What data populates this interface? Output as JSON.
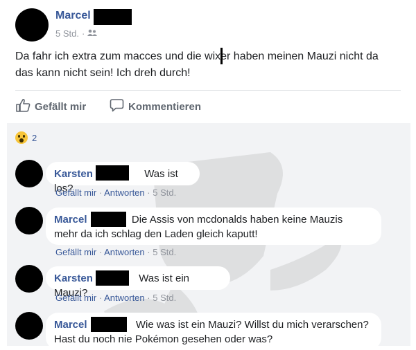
{
  "post": {
    "author": "Marcel",
    "time": "5 Std.",
    "meta_separator": "·",
    "audience_icon": "friends-icon",
    "text_line1": "Da fahr ich extra zum macces und die wixer haben meinen Mauzi nicht da",
    "text_line2": "das kann nicht sein! Ich dreh durch!"
  },
  "actions": {
    "like": "Gefällt mir",
    "like_icon": "thumbs-up-icon",
    "comment": "Kommentieren",
    "comment_icon": "speech-bubble-icon"
  },
  "reactions": {
    "icon": "wow-reaction-icon",
    "count": "2"
  },
  "comment_actions": {
    "like": "Gefällt mir",
    "reply": "Antworten",
    "separator": "·"
  },
  "comments": [
    {
      "author": "Karsten",
      "text": "Was ist los?",
      "time": "5 Std."
    },
    {
      "author": "Marcel",
      "text_line1": "Die Assis von mcdonalds haben keine Mauzis",
      "text_line2": "mehr da ich schlag den Laden gleich kaputt!",
      "time": "5 Std."
    },
    {
      "author": "Karsten",
      "text": "Was ist ein Mauzi?",
      "time": "5 Std."
    },
    {
      "author": "Marcel",
      "text_line1": "Wie was ist ein Mauzi? Willst du mich verarschen?",
      "text_line2": "Hast du noch nie Pokémon gesehen oder was?"
    }
  ],
  "colors": {
    "link": "#385898",
    "meta": "#90949c",
    "comments_bg": "#f2f3f5",
    "redaction": "#000000"
  }
}
